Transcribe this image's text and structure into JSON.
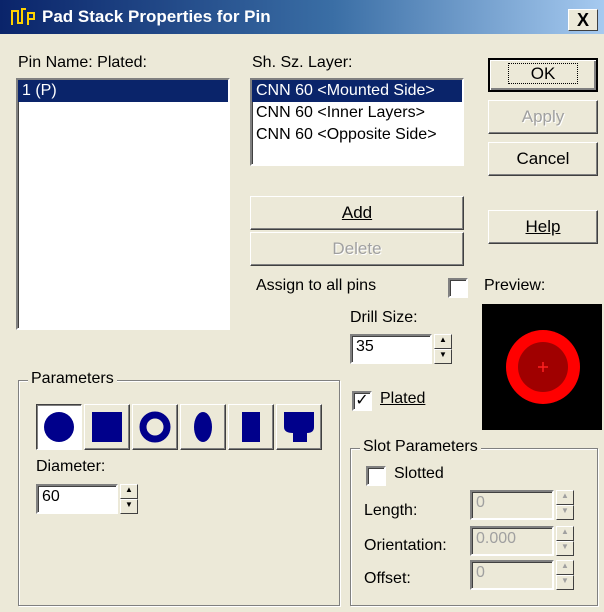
{
  "window": {
    "title": "Pad Stack Properties for Pin",
    "close_label": "X"
  },
  "pins": {
    "header": "Pin Name:  Plated:",
    "items": [
      "1 (P)"
    ],
    "selected_index": 0
  },
  "layers": {
    "header": "Sh. Sz. Layer:",
    "items": [
      "CNN 60 <Mounted Side>",
      "CNN 60 <Inner Layers>",
      "CNN 60 <Opposite Side>"
    ],
    "selected_index": 0
  },
  "buttons": {
    "ok": "OK",
    "apply": "Apply",
    "cancel": "Cancel",
    "add": "Add",
    "delete": "Delete",
    "help": "Help"
  },
  "assign_all": {
    "label": "Assign to all pins",
    "checked": false
  },
  "preview": {
    "label": "Preview:",
    "colors": {
      "outer": "#ff0000",
      "inner": "#9b0000",
      "background": "#000000"
    }
  },
  "drill": {
    "label": "Drill Size:",
    "value": "35"
  },
  "plated": {
    "label": "Plated",
    "checked": true
  },
  "parameters": {
    "legend": "Parameters",
    "shapes": [
      "round-shape",
      "square-shape",
      "annulus-shape",
      "oval-shape",
      "rectangle-shape",
      "custom-shape"
    ],
    "selected_shape": 0,
    "diameter_label": "Diameter:",
    "diameter_value": "60",
    "shape_color": "#00008b"
  },
  "slot": {
    "legend": "Slot Parameters",
    "slotted_label": "Slotted",
    "slotted_checked": false,
    "length_label": "Length:",
    "length_value": "0",
    "orientation_label": "Orientation:",
    "orientation_value": "0.000",
    "offset_label": "Offset:",
    "offset_value": "0"
  }
}
